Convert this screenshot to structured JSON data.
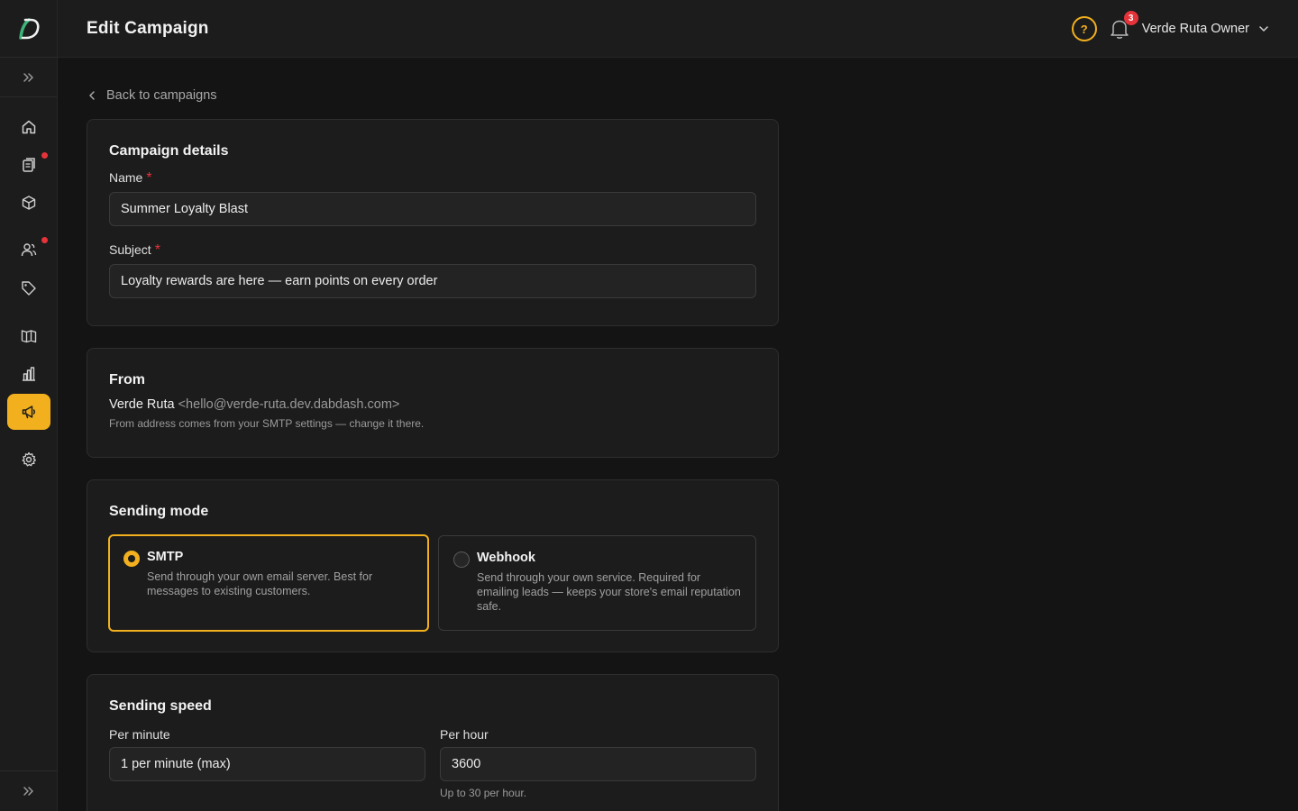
{
  "header": {
    "title": "Edit Campaign",
    "help_symbol": "?",
    "notification_count": "3",
    "user_name": "Verde Ruta Owner"
  },
  "sidebar": {
    "items": [
      {
        "icon": "home-icon",
        "has_dot": false
      },
      {
        "icon": "orders-icon",
        "has_dot": true
      },
      {
        "icon": "products-icon",
        "has_dot": false
      },
      {
        "icon": "customers-icon",
        "has_dot": true
      },
      {
        "icon": "tag-icon",
        "has_dot": false
      },
      {
        "icon": "book-icon",
        "has_dot": false
      },
      {
        "icon": "analytics-icon",
        "has_dot": false
      },
      {
        "icon": "megaphone-icon",
        "active": true
      },
      {
        "icon": "gear-icon",
        "has_dot": false
      }
    ]
  },
  "back_link": "Back to campaigns",
  "campaign_details": {
    "title": "Campaign details",
    "name_label": "Name",
    "name_value": "Summer Loyalty Blast",
    "subject_label": "Subject",
    "subject_value": "Loyalty rewards are here — earn points on every order",
    "required_mark": "*"
  },
  "from": {
    "title": "From",
    "sender_name": "Verde Ruta",
    "sender_email": "<hello@verde-ruta.dev.dabdash.com>",
    "hint": "From address comes from your SMTP settings — change it there."
  },
  "sending_mode": {
    "title": "Sending mode",
    "options": [
      {
        "title": "SMTP",
        "description": "Send through your own email server. Best for messages to existing customers.",
        "selected": true
      },
      {
        "title": "Webhook",
        "description": "Send through your own service. Required for emailing leads — keeps your store's email reputation safe.",
        "selected": false
      }
    ]
  },
  "sending_speed": {
    "title": "Sending speed",
    "per_minute_label": "Per minute",
    "per_minute_value": "1 per minute (max)",
    "per_hour_label": "Per hour",
    "per_hour_value": "3600",
    "per_hour_hint": "Up to 30 per hour."
  },
  "colors": {
    "accent": "#f2b01e",
    "badge": "#e5333a",
    "background": "#141414",
    "surface": "#1c1c1c"
  }
}
